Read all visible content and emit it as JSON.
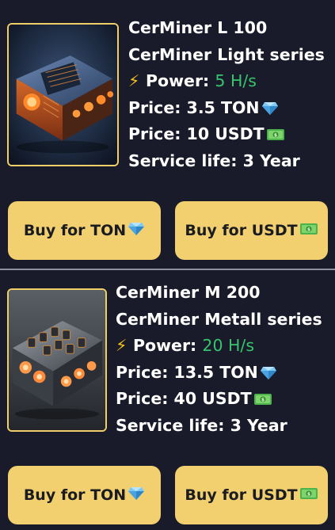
{
  "products": [
    {
      "name": "CerMiner L 100",
      "series": "CerMiner Light series",
      "power_label": "Power: ",
      "power_value": "5 H/s",
      "price_ton": "Price: 3.5 TON",
      "price_usdt": "Price: 10 USDT",
      "service_life": "Service life: 3 Year",
      "buy_ton_label": "Buy for TON",
      "buy_usdt_label": "Buy for USDT",
      "image_icon": "miner-device-image"
    },
    {
      "name": "CerMiner M 200",
      "series": "CerMiner Metall series",
      "power_label": "Power: ",
      "power_value": "20 H/s",
      "price_ton": "Price: 13.5 TON",
      "price_usdt": "Price: 40 USDT",
      "service_life": "Service life: 3 Year",
      "buy_ton_label": "Buy for TON",
      "buy_usdt_label": "Buy for USDT",
      "image_icon": "miner-device-image"
    }
  ],
  "icons": {
    "bolt": "lightning-icon",
    "ton": "gem-icon",
    "usdt": "dollar-banknote-icon"
  },
  "colors": {
    "background": "#1a1b2a",
    "accent_button": "#f2d06f",
    "power_value": "#36c46c",
    "image_border": "#f0cf68"
  }
}
